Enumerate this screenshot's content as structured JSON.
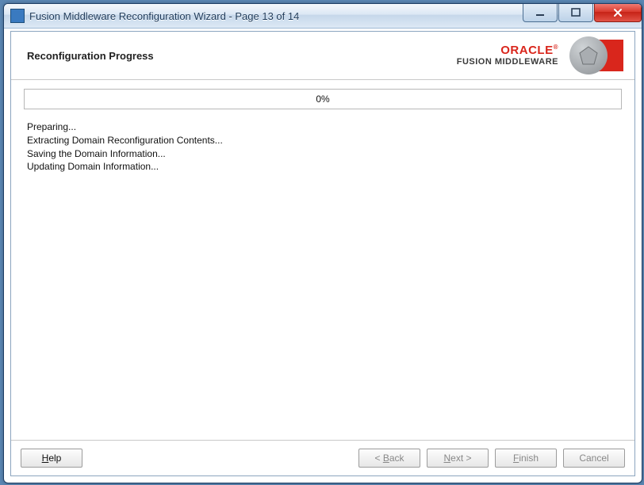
{
  "window": {
    "title": "Fusion Middleware Reconfiguration Wizard - Page 13 of 14"
  },
  "header": {
    "page_title": "Reconfiguration Progress",
    "brand_line1": "ORACLE",
    "brand_tm": "®",
    "brand_line2": "FUSION MIDDLEWARE"
  },
  "progress": {
    "percent_text": "0%",
    "log": [
      "Preparing...",
      "Extracting Domain Reconfiguration Contents...",
      "Saving the Domain Information...",
      "Updating Domain Information..."
    ]
  },
  "footer": {
    "help": "Help",
    "back": "Back",
    "next": "Next",
    "finish": "Finish",
    "cancel": "Cancel"
  }
}
